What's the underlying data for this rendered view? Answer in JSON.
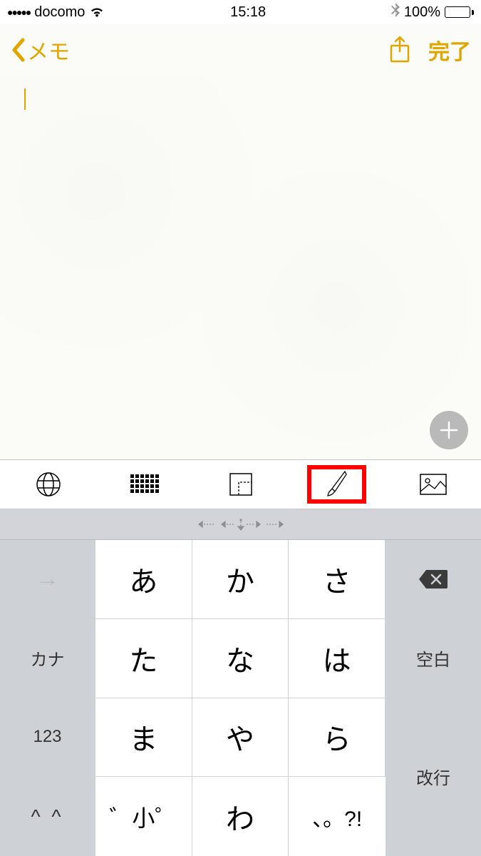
{
  "status": {
    "carrier": "docomo",
    "signal_dots": "●●●●●",
    "time": "15:18",
    "battery_pct": "100%"
  },
  "nav": {
    "back_label": "メモ",
    "done_label": "完了"
  },
  "toolbar": {
    "items": [
      "globe",
      "grid",
      "trim",
      "brush",
      "photo"
    ],
    "highlighted": "brush"
  },
  "keyboard": {
    "side_left": {
      "arrow": "→",
      "kana": "カナ",
      "num": "123",
      "emoji": "^ ^"
    },
    "side_right": {
      "space": "空白",
      "enter": "改行"
    },
    "rows": [
      [
        "あ",
        "か",
        "さ"
      ],
      [
        "た",
        "な",
        "は"
      ],
      [
        "ま",
        "や",
        "ら"
      ],
      [
        "゛小゜",
        "わ",
        "、。?!"
      ]
    ]
  }
}
